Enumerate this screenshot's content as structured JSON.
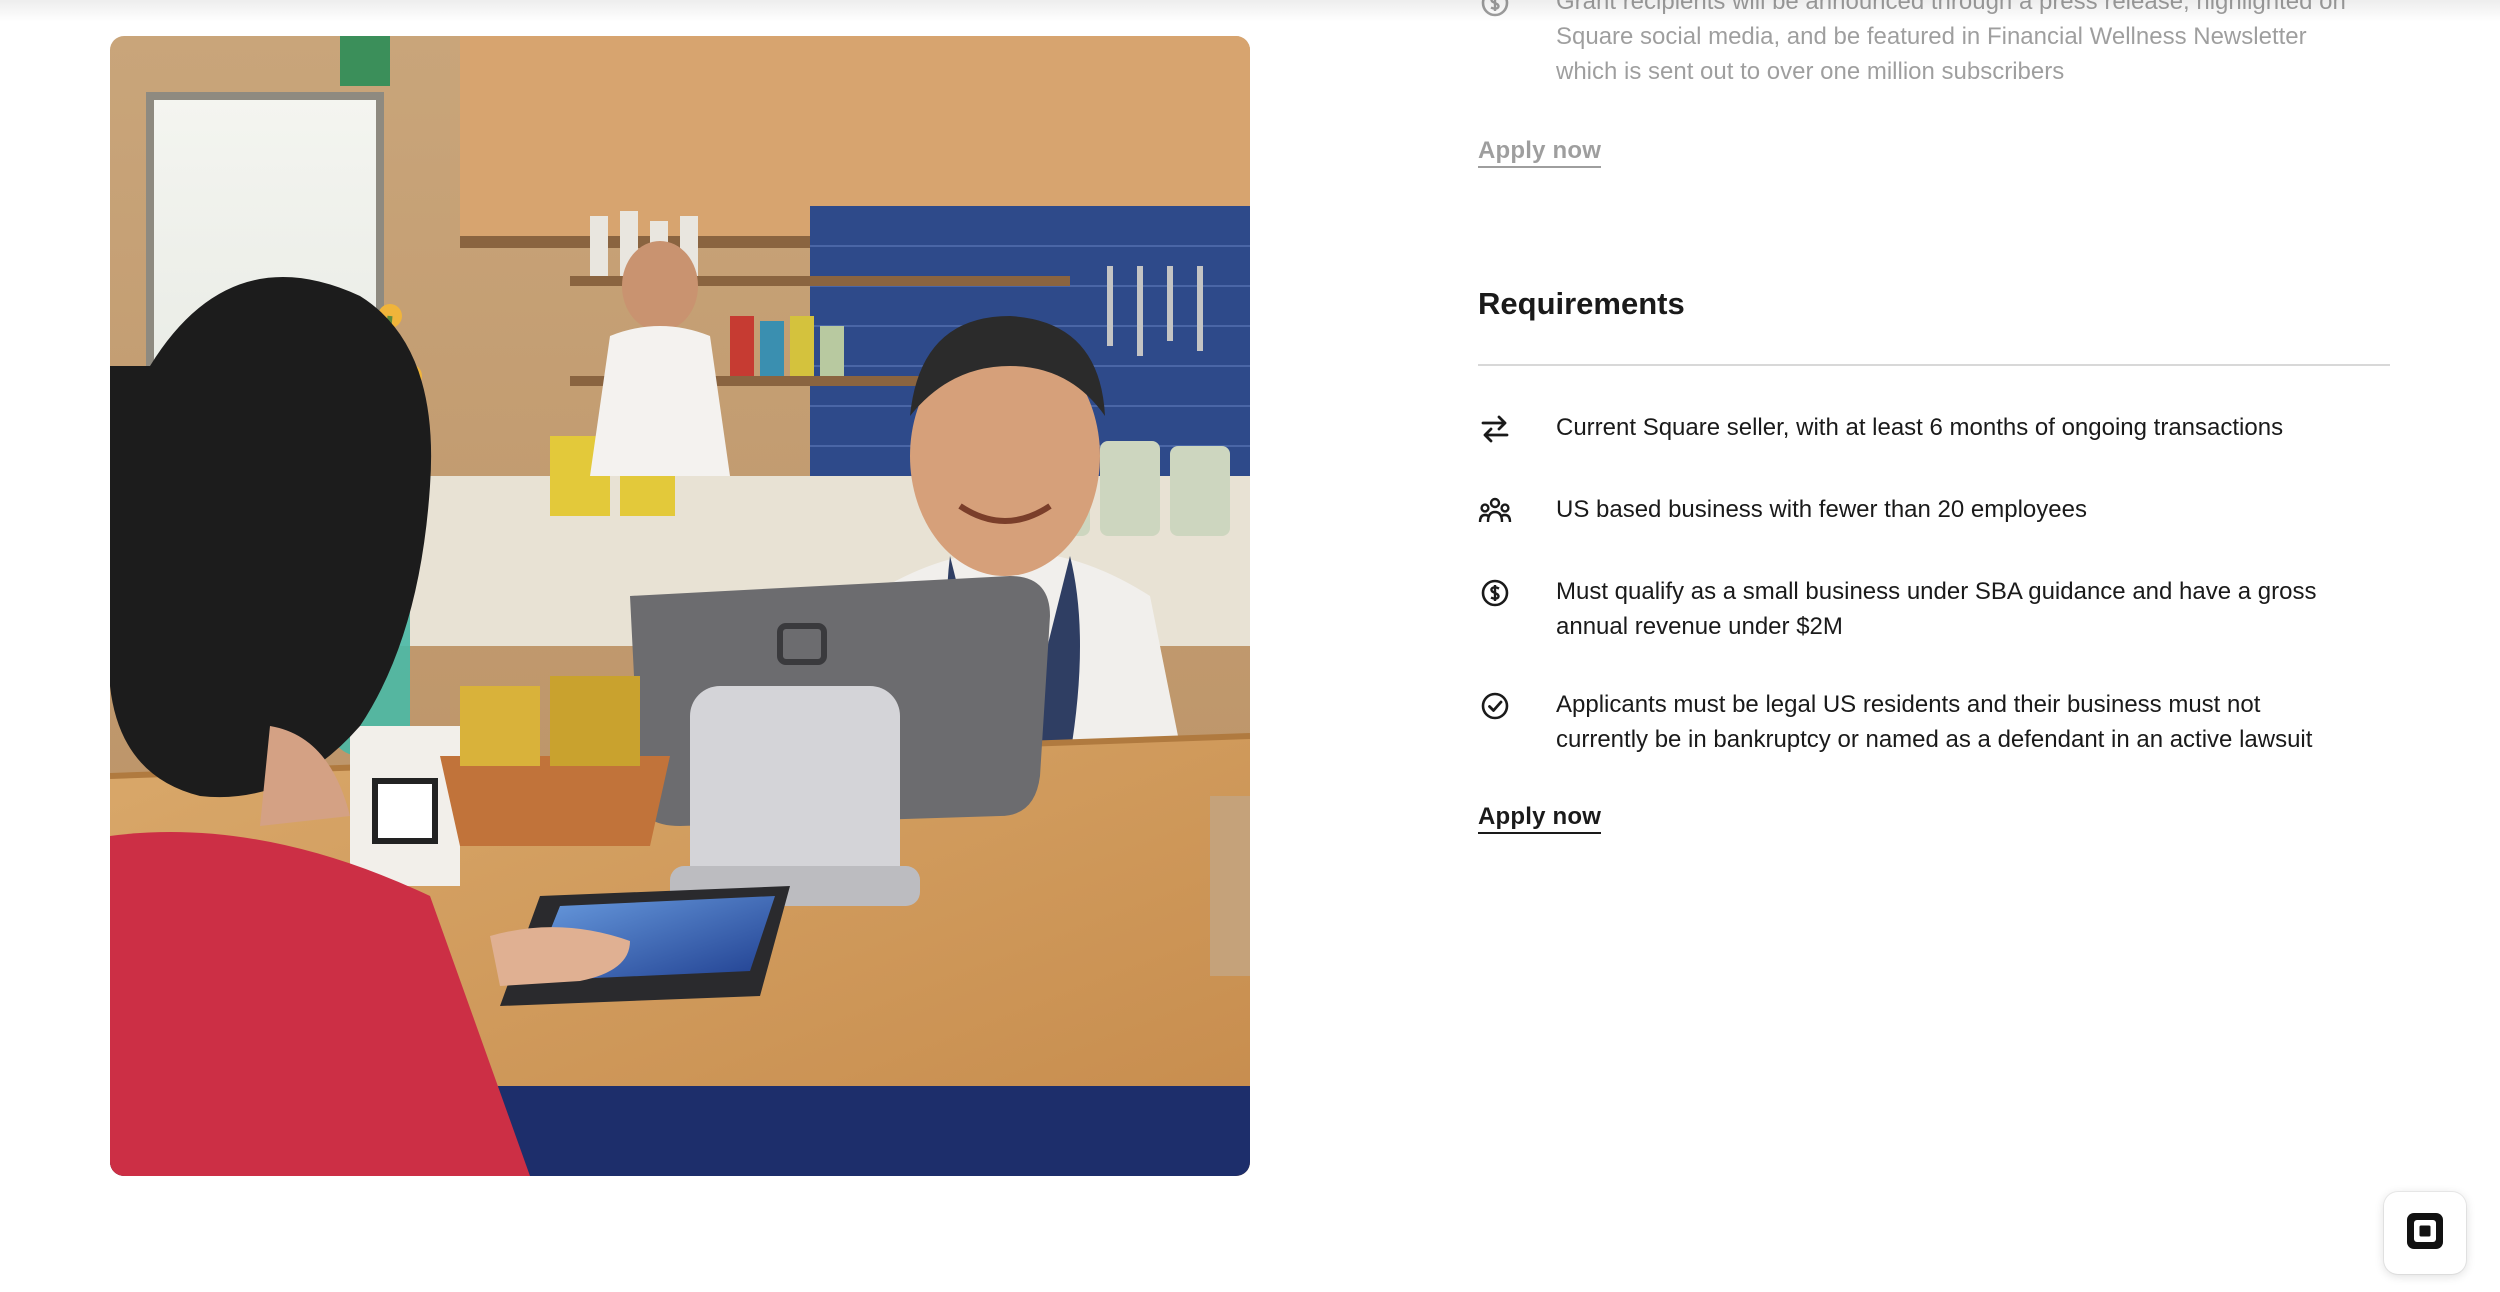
{
  "announcement": {
    "text": "Grant recipients will be announced through a press release, highlighted on Square social media, and be featured in Financial Wellness Newsletter which is sent out to over one million subscribers",
    "icon": "dollar-circle-icon"
  },
  "apply_top": {
    "label": "Apply now"
  },
  "requirements": {
    "title": "Requirements",
    "items": [
      {
        "icon": "transfer-arrows-icon",
        "text": "Current Square seller, with at least 6 months of ongoing transactions"
      },
      {
        "icon": "people-group-icon",
        "text": "US based business with fewer than 20 employees"
      },
      {
        "icon": "dollar-circle-icon",
        "text": "Must qualify as a small business under SBA guidance and have a gross annual revenue under $2M"
      },
      {
        "icon": "check-circle-icon",
        "text": "Applicants must be legal US residents and their business must not currently be in bankruptcy or named as a defendant in an active lawsuit"
      }
    ]
  },
  "apply_bottom": {
    "label": "Apply now"
  },
  "photo": {
    "subject": "cafe-checkout-photo"
  },
  "badge": {
    "icon": "square-logo-icon"
  },
  "colors": {
    "text": "#1a1a1a",
    "rule": "#d8d8d8",
    "background": "#ffffff"
  }
}
